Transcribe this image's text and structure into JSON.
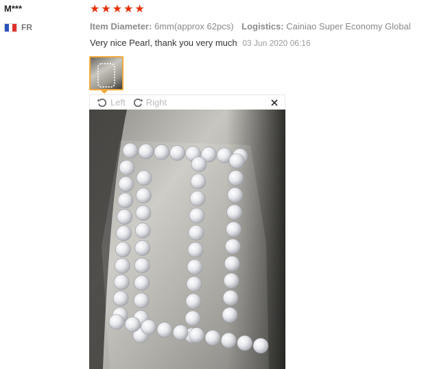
{
  "user": {
    "name": "M***",
    "country": "FR",
    "flag_colors": [
      "#2a52be",
      "#ffffff",
      "#e0312b"
    ]
  },
  "rating": {
    "stars": 5,
    "color": "#e62e04",
    "glyph": "★"
  },
  "attributes": [
    {
      "key": "Item Diameter:",
      "value": "6mm(approx 62pcs)"
    },
    {
      "key": "Logistics:",
      "value": "Cainiao Super Economy Global"
    }
  ],
  "feedback": {
    "text": "Very nice Pearl, thank you very much",
    "time": "03 Jun 2020 06:16"
  },
  "viewer": {
    "rotate_left_label": "Left",
    "rotate_right_label": "Right",
    "rotate_left_icon": "rotate-left-icon",
    "rotate_right_icon": "rotate-right-icon",
    "close_icon": "close-icon",
    "accent": "#f2a93b"
  }
}
